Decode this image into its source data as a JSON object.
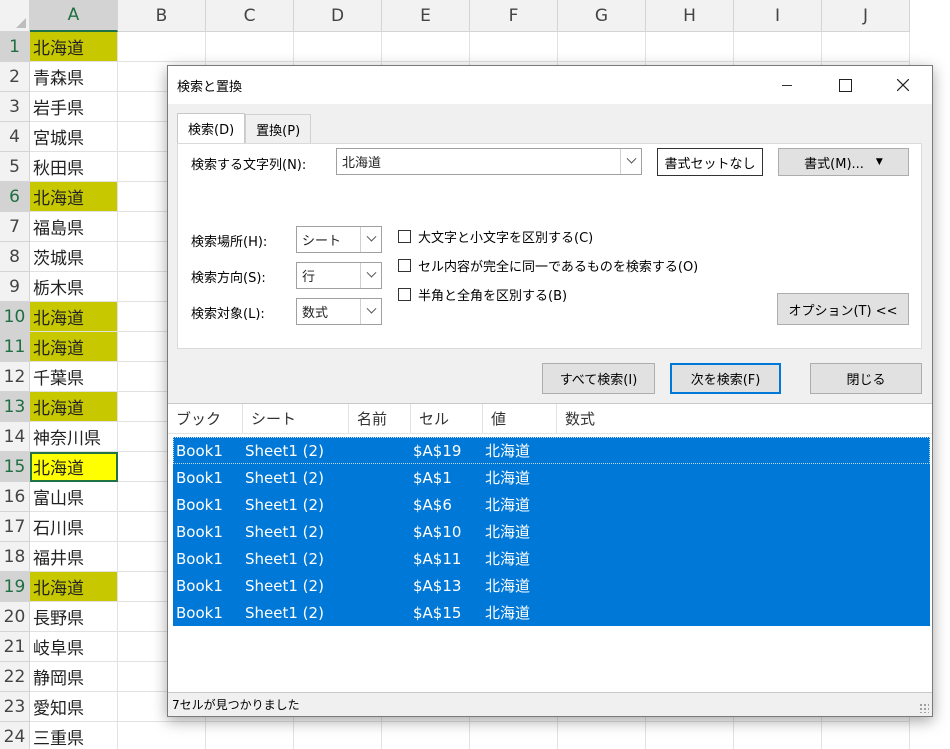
{
  "spreadsheet": {
    "columns": [
      "A",
      "B",
      "C",
      "D",
      "E",
      "F",
      "G",
      "H",
      "I",
      "J"
    ],
    "active_column": "A",
    "rows": [
      {
        "num": "1",
        "value": "北海道",
        "highlight": true,
        "active": false
      },
      {
        "num": "2",
        "value": "青森県",
        "highlight": false,
        "active": false
      },
      {
        "num": "3",
        "value": "岩手県",
        "highlight": false,
        "active": false
      },
      {
        "num": "4",
        "value": "宮城県",
        "highlight": false,
        "active": false
      },
      {
        "num": "5",
        "value": "秋田県",
        "highlight": false,
        "active": false
      },
      {
        "num": "6",
        "value": "北海道",
        "highlight": true,
        "active": false
      },
      {
        "num": "7",
        "value": "福島県",
        "highlight": false,
        "active": false
      },
      {
        "num": "8",
        "value": "茨城県",
        "highlight": false,
        "active": false
      },
      {
        "num": "9",
        "value": "栃木県",
        "highlight": false,
        "active": false
      },
      {
        "num": "10",
        "value": "北海道",
        "highlight": true,
        "active": false
      },
      {
        "num": "11",
        "value": "北海道",
        "highlight": true,
        "active": false
      },
      {
        "num": "12",
        "value": "千葉県",
        "highlight": false,
        "active": false
      },
      {
        "num": "13",
        "value": "北海道",
        "highlight": true,
        "active": false
      },
      {
        "num": "14",
        "value": "神奈川県",
        "highlight": false,
        "active": false
      },
      {
        "num": "15",
        "value": "北海道",
        "highlight": true,
        "active": true
      },
      {
        "num": "16",
        "value": "富山県",
        "highlight": false,
        "active": false
      },
      {
        "num": "17",
        "value": "石川県",
        "highlight": false,
        "active": false
      },
      {
        "num": "18",
        "value": "福井県",
        "highlight": false,
        "active": false
      },
      {
        "num": "19",
        "value": "北海道",
        "highlight": true,
        "active": false
      },
      {
        "num": "20",
        "value": "長野県",
        "highlight": false,
        "active": false
      },
      {
        "num": "21",
        "value": "岐阜県",
        "highlight": false,
        "active": false
      },
      {
        "num": "22",
        "value": "静岡県",
        "highlight": false,
        "active": false
      },
      {
        "num": "23",
        "value": "愛知県",
        "highlight": false,
        "active": false
      },
      {
        "num": "24",
        "value": "三重県",
        "highlight": false,
        "active": false
      }
    ],
    "colors": {
      "highlight": "#c8c800",
      "active_fill": "#ffff00",
      "accent": "#217346"
    }
  },
  "dialog": {
    "title": "検索と置換",
    "tabs": [
      {
        "label": "検索(D)"
      },
      {
        "label": "置換(P)"
      }
    ],
    "find_label": "検索する文字列(N):",
    "find_value": "北海道",
    "format_status": "書式セットなし",
    "format_button": "書式(M)...",
    "within_label": "検索場所(H):",
    "within_value": "シート",
    "search_label": "検索方向(S):",
    "search_value": "行",
    "lookin_label": "検索対象(L):",
    "lookin_value": "数式",
    "options": [
      {
        "label": "大文字と小文字を区別する(C)",
        "checked": false
      },
      {
        "label": "セル内容が完全に同一であるものを検索する(O)",
        "checked": false
      },
      {
        "label": "半角と全角を区別する(B)",
        "checked": false
      }
    ],
    "options_button": "オプション(T) <<",
    "find_all_button": "すべて検索(I)",
    "find_next_button": "次を検索(F)",
    "close_button": "閉じる",
    "results": {
      "headers": [
        "ブック",
        "シート",
        "名前",
        "セル",
        "値",
        "数式"
      ],
      "rows": [
        {
          "book": "Book1",
          "sheet": "Sheet1 (2)",
          "name": "",
          "cell": "$A$19",
          "value": "北海道",
          "formula": ""
        },
        {
          "book": "Book1",
          "sheet": "Sheet1 (2)",
          "name": "",
          "cell": "$A$1",
          "value": "北海道",
          "formula": ""
        },
        {
          "book": "Book1",
          "sheet": "Sheet1 (2)",
          "name": "",
          "cell": "$A$6",
          "value": "北海道",
          "formula": ""
        },
        {
          "book": "Book1",
          "sheet": "Sheet1 (2)",
          "name": "",
          "cell": "$A$10",
          "value": "北海道",
          "formula": ""
        },
        {
          "book": "Book1",
          "sheet": "Sheet1 (2)",
          "name": "",
          "cell": "$A$11",
          "value": "北海道",
          "formula": ""
        },
        {
          "book": "Book1",
          "sheet": "Sheet1 (2)",
          "name": "",
          "cell": "$A$13",
          "value": "北海道",
          "formula": ""
        },
        {
          "book": "Book1",
          "sheet": "Sheet1 (2)",
          "name": "",
          "cell": "$A$15",
          "value": "北海道",
          "formula": ""
        }
      ],
      "selection_color": "#0078d7"
    },
    "status": "7セルが見つかりました",
    "window_controls": {
      "minimize": "minimize-icon",
      "maximize": "maximize-icon",
      "close": "close-icon"
    }
  }
}
